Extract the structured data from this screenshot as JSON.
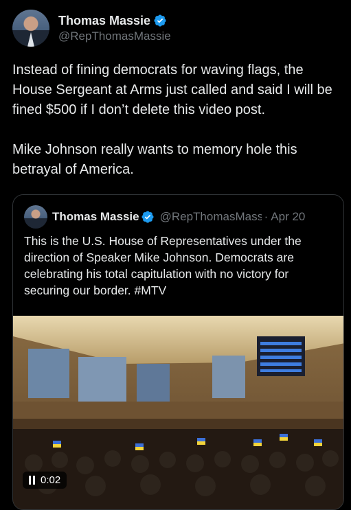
{
  "post": {
    "author_name": "Thomas Massie",
    "author_handle": "@RepThomasMassie",
    "text_paragraph_1": "Instead of fining democrats for waving flags, the House Sergeant at Arms just called and said I will be fined $500 if I don’t delete this video post.",
    "text_paragraph_2": "Mike Johnson really wants to memory hole this betrayal of America."
  },
  "quoted_post": {
    "author_name": "Thomas Massie",
    "author_handle": "@RepThomasMassie",
    "date": "Apr 20",
    "separator": "·",
    "text": "This is the U.S. House of Representatives under the direction of Speaker Mike Johnson. Democrats are celebrating his total capitulation with no victory for securing our border. #MTV",
    "video": {
      "timestamp": "0:02",
      "state": "pause-icon"
    }
  },
  "colors": {
    "background": "#000000",
    "text_primary": "#e7e9ea",
    "text_secondary": "#71767b",
    "verified_badge": "#1d9bf0",
    "border": "#2f3336"
  }
}
